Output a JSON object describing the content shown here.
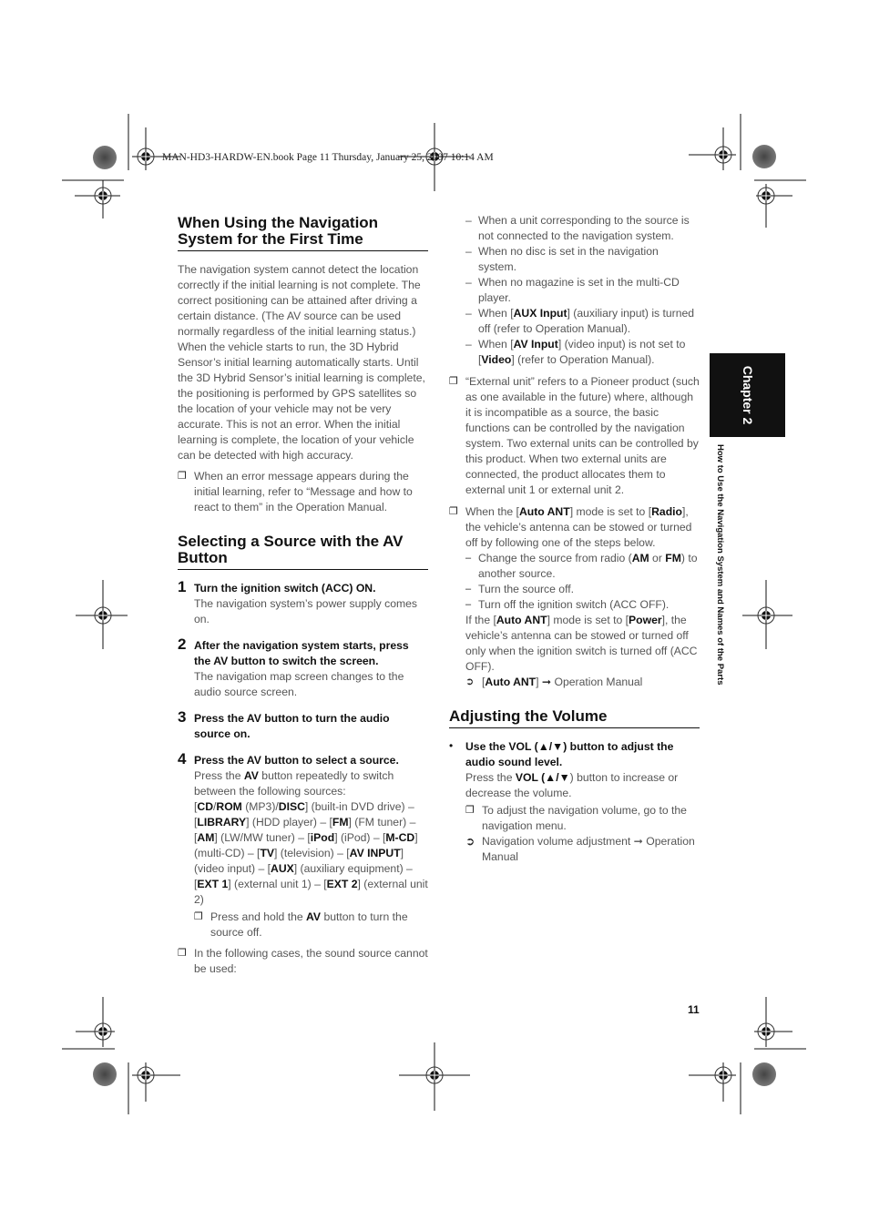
{
  "header": {
    "print_info": "MAN-HD3-HARDW-EN.book  Page 11  Thursday, January 25, 2007  10:14 AM"
  },
  "sidebar": {
    "chapter": "Chapter 2",
    "chapter_title": "How to Use the Navigation System and Names of the Parts"
  },
  "page_number": "11",
  "left": {
    "section1": {
      "title_line1": "When Using the Navigation",
      "title_line2": "System for the First Time",
      "para1": "The navigation system cannot detect the location correctly if the initial learning is not complete. The correct positioning can be attained after driving a certain distance. (The AV source can be used normally regardless of the initial learning status.)",
      "para2": "When the vehicle starts to run, the 3D Hybrid Sensor’s initial learning automatically starts. Until the 3D Hybrid Sensor’s initial learning is complete, the positioning is performed by GPS satellites so the location of your vehicle may not be very accurate. This is not an error. When the initial learning is complete, the location of your vehicle can be detected with high accuracy.",
      "note1": "When an error message appears during the initial learning, refer to “Message and how to react to them” in the Operation Manual."
    },
    "section2": {
      "title_line1": "Selecting a Source with the AV",
      "title_line2": "Button",
      "steps": [
        {
          "num": "1",
          "title": "Turn the ignition switch (ACC) ON.",
          "body": "The navigation system’s power supply comes on."
        },
        {
          "num": "2",
          "title": "After the navigation system starts, press the AV button to switch the screen.",
          "body": "The navigation map screen changes to the audio source screen."
        },
        {
          "num": "3",
          "title": "Press the AV button to turn the audio source on.",
          "body": ""
        },
        {
          "num": "4",
          "title": "Press the AV button to select a source.",
          "body_pre": "Press the ",
          "body_bold": "AV",
          "body_post": " button repeatedly to switch between the following sources:"
        }
      ],
      "sources": [
        {
          "b": "CD",
          "t": "/"
        },
        {
          "b": "ROM",
          "t": " (MP3)/"
        },
        {
          "b": "DISC",
          "t": "] (built-in DVD drive) – ["
        },
        {
          "b": "LIBRARY",
          "t": "] (HDD player) – ["
        },
        {
          "b": "FM",
          "t": "] (FM tuner) – ["
        },
        {
          "b": "AM",
          "t": "] (LW/MW tuner) – ["
        },
        {
          "b": "iPod",
          "t": "] (iPod) – ["
        },
        {
          "b": "M-CD",
          "t": "] (multi-CD) – ["
        },
        {
          "b": "TV",
          "t": "] (television) – ["
        },
        {
          "b": "AV INPUT",
          "t": "] (video input) – ["
        },
        {
          "b": "AUX",
          "t": "] (auxiliary equipment) – ["
        },
        {
          "b": "EXT 1",
          "t": "] (external unit 1) – ["
        },
        {
          "b": "EXT 2",
          "t": "] (external unit 2)"
        }
      ],
      "note_hold_pre": "Press and hold the ",
      "note_hold_bold": "AV",
      "note_hold_post": " button to turn the source off.",
      "note_cases": "In the following cases, the sound source cannot be used:"
    }
  },
  "right": {
    "cases": [
      "When a unit corresponding to the source is not connected to the navigation system.",
      "When no disc is set in the navigation system.",
      "When no magazine is set in the multi-CD player."
    ],
    "case_aux": {
      "pre": "When [",
      "bold": "AUX Input",
      "post": "] (auxiliary input) is turned off (refer to Operation Manual)."
    },
    "case_av": {
      "pre": "When [",
      "bold": "AV Input",
      "mid": "] (video input) is not set to [",
      "bold2": "Video",
      "post": "] (refer to Operation Manual)."
    },
    "note_external": "“External unit” refers to a Pioneer product (such as one available in the future) where, although it is incompatible as a source, the basic functions can be controlled by the navigation system. Two external units can be controlled by this product. When two external units are connected, the product allocates them to external unit 1 or external unit 2.",
    "note_ant": {
      "p1": "When the [",
      "b1": "Auto ANT",
      "p2": "] mode is set to [",
      "b2": "Radio",
      "p3": "], the vehicle’s antenna can be stowed or turned off by following one of the steps below.",
      "steps": [
        {
          "pre": "Change the source from radio (",
          "b1": "AM",
          "mid": " or ",
          "b2": "FM",
          "post": ") to another source."
        },
        {
          "pre": "Turn the source off."
        },
        {
          "pre": "Turn off the ignition switch (ACC OFF)."
        }
      ],
      "power_p1": "If the [",
      "power_b1": "Auto ANT",
      "power_p2": "] mode is set to [",
      "power_b2": "Power",
      "power_p3": "], the vehicle’s antenna can be stowed or turned off only when the ignition switch is turned off (ACC OFF).",
      "ref_bold": "Auto ANT",
      "ref_post": " Operation Manual"
    },
    "section3": {
      "title": "Adjusting the Volume",
      "bullet_title": "Use the VOL (▲/▼) button to adjust the audio sound level.",
      "body_pre": "Press the ",
      "body_bold": "VOL (▲/▼",
      "body_post": ") button to increase or decrease the volume.",
      "note": "To adjust the navigation volume, go to the navigation menu.",
      "ref": "Navigation volume adjustment ➞ Operation Manual"
    }
  }
}
